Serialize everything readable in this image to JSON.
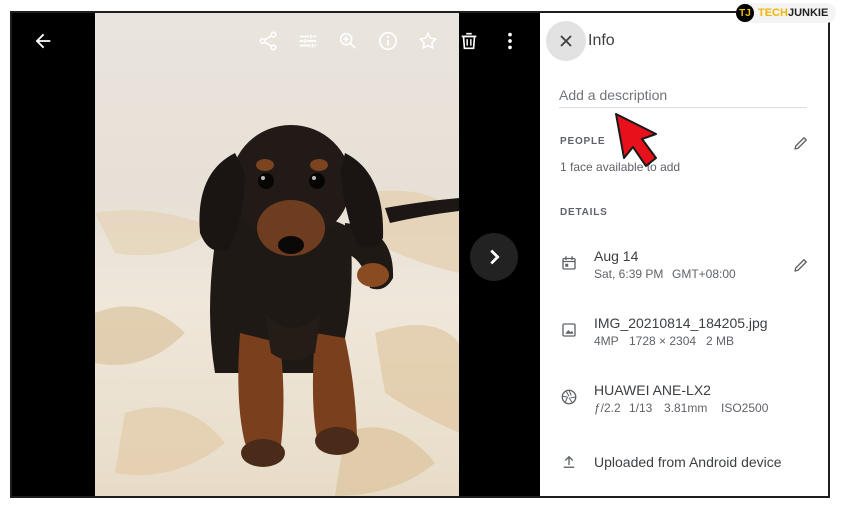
{
  "viewer": {
    "toolbar_icons": [
      "back-arrow-icon",
      "share-icon",
      "edit-adjust-icon",
      "zoom-in-icon",
      "info-icon",
      "star-icon",
      "trash-icon",
      "more-vert-icon"
    ]
  },
  "info": {
    "title": "Info",
    "description_placeholder": "Add a description",
    "people_label": "PEOPLE",
    "people_text": "1 face available to add",
    "details_label": "DETAILS",
    "date": "Aug 14",
    "time": "Sat, 6:39 PM",
    "timezone": "GMT+08:00",
    "filename": "IMG_20210814_184205.jpg",
    "megapixels": "4MP",
    "resolution": "1728 × 2304",
    "filesize": "2 MB",
    "camera": "HUAWEI ANE-LX2",
    "aperture": "ƒ/2.2",
    "shutter": "1/13",
    "focal": "3.81mm",
    "iso": "ISO2500",
    "upload_source": "Uploaded from Android device"
  },
  "watermark": {
    "brand_a": "TECH",
    "brand_b": "JUNKIE",
    "logo": "TJ"
  },
  "colors": {
    "accent_arrow": "#e8101a",
    "panel_bg": "#ffffff",
    "viewer_bg": "#000000"
  }
}
